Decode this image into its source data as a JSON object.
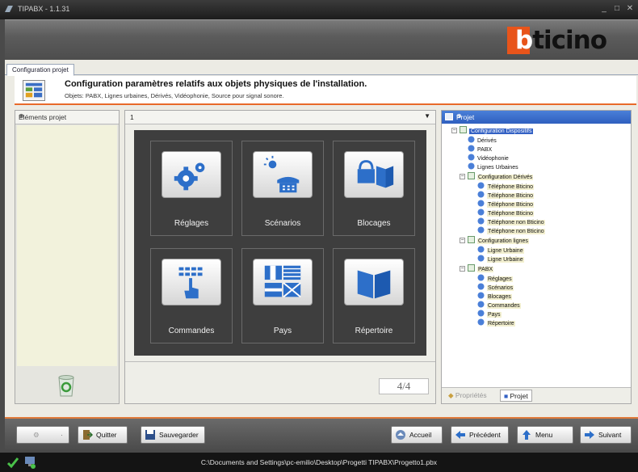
{
  "window": {
    "title": "TIPABX - 1.1.31"
  },
  "brand": {
    "logo_b": "b",
    "logo_rest": "ticino"
  },
  "tab": {
    "label": "Configuration projet"
  },
  "banner": {
    "title": "Configuration paramètres relatifs aux objets physiques de l'installation.",
    "subtitle": "Objets: PABX, Lignes urbaines, Dérivés, Vidéophonie, Source pour signal sonore."
  },
  "left_panel": {
    "title": "Eléments projet",
    "pin": "⊕"
  },
  "center": {
    "selector_value": "1",
    "page_indicator": "4/4",
    "tiles": [
      {
        "label": "Réglages",
        "icon": "gears-icon"
      },
      {
        "label": "Scénarios",
        "icon": "sun-phone-icon"
      },
      {
        "label": "Blocages",
        "icon": "lock-book-icon"
      },
      {
        "label": "Commandes",
        "icon": "keypad-hand-icon"
      },
      {
        "label": "Pays",
        "icon": "flags-icon"
      },
      {
        "label": "Répertoire",
        "icon": "book-icon"
      }
    ]
  },
  "right_panel": {
    "title": "Projet",
    "tree": {
      "root": "Configuration Dispositifs",
      "root_children": [
        "Dérivés",
        "PABX",
        "Vidéophonie",
        "Lignes Urbaines"
      ],
      "config_derives": "Configuration Dérivés",
      "derives": [
        "Téléphone Bticino",
        "Téléphone Bticino",
        "Téléphone Bticino",
        "Téléphone Bticino",
        "Téléphone non Bticino",
        "Téléphone non Bticino"
      ],
      "config_lignes": "Configuration lignes",
      "lignes": [
        "Ligne Urbaine",
        "Ligne Urbaine"
      ],
      "pabx": "PABX",
      "pabx_children": [
        "Réglages",
        "Scénarios",
        "Blocages",
        "Commandes",
        "Pays",
        "Répertoire"
      ]
    },
    "tabs": {
      "properties": "Propriétés",
      "project": "Projet"
    }
  },
  "toolbar": {
    "quit": "Quitter",
    "save": "Sauvegarder",
    "home": "Accueil",
    "previous": "Précédent",
    "menu": "Menu",
    "next": "Suivant"
  },
  "status": {
    "path": "C:\\Documents and Settings\\pc-emilio\\Desktop\\Progetti TIPABX\\Progetto1.pbx"
  },
  "colors": {
    "accent_orange": "#e8541a",
    "selection_blue": "#3361c4",
    "tile_bg": "#3e3e3e"
  }
}
